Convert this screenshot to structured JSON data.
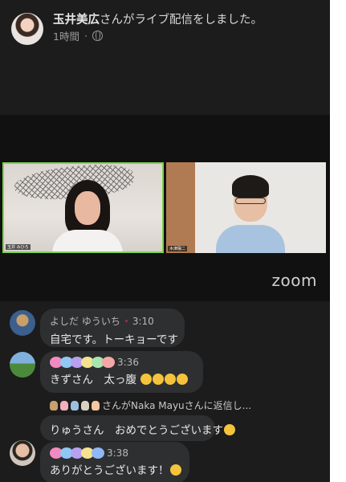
{
  "post": {
    "host_name": "玉井美広",
    "action": "さんがライブ配信をしました。",
    "time": "1時間",
    "globe_icon": "globe-icon"
  },
  "video": {
    "left_participant": "玉井 みひろ",
    "right_participant": "木津陽二",
    "logo": "zoom"
  },
  "comments": [
    {
      "name": "よしだ ゆういち",
      "time": "3:10",
      "text": "自宅です。トーキョーです"
    },
    {
      "name": "",
      "time": "3:36",
      "text": "きずさん　太っ腹"
    },
    {
      "reply_name": "さんがNaka Mayuさんに返信し...",
      "text": "りゅうさん　おめでとうございます"
    },
    {
      "name": "",
      "time": "3:38",
      "text": "ありがとうございます！"
    }
  ],
  "colors": {
    "background": "#1c1c1c",
    "bubble": "#2e2f31",
    "active_speaker": "#7bd34f"
  }
}
